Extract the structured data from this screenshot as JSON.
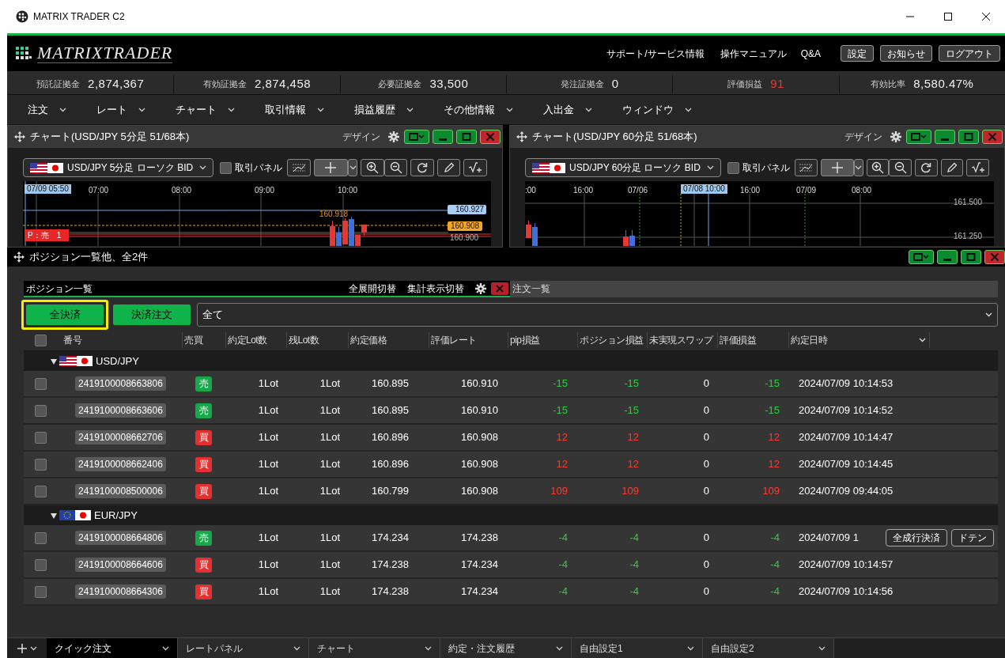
{
  "window": {
    "title": "MATRIX TRADER C2"
  },
  "header": {
    "logo": "MATRIXTRADER",
    "links": [
      "サポート/サービス情報",
      "操作マニュアル",
      "Q&A"
    ],
    "buttons": [
      "設定",
      "お知らせ",
      "ログアウト"
    ]
  },
  "account": [
    {
      "label": "預託証拠金",
      "value": "2,874,367",
      "kind": "plain"
    },
    {
      "label": "有効証拠金",
      "value": "2,874,458",
      "kind": "plain"
    },
    {
      "label": "必要証拠金",
      "value": "33,500",
      "kind": "plain"
    },
    {
      "label": "発注証拠金",
      "value": "0",
      "kind": "plain"
    },
    {
      "label": "評価損益",
      "value": "91",
      "kind": "gain"
    },
    {
      "label": "有効比率",
      "value": "8,580.47%",
      "kind": "plain"
    }
  ],
  "menu": [
    "注文",
    "レート",
    "チャート",
    "取引情報",
    "損益履歴",
    "その他情報",
    "入出金",
    "ウィンドウ"
  ],
  "charts": [
    {
      "title": "チャート(USD/JPY 5分足 51/68本)",
      "design": "デザイン",
      "symbol": "USD/JPY 5分足 ローソク BID",
      "panel_toggle": {
        "label": "取引パネル",
        "checked": false
      },
      "labels": [
        {
          "text": "07/09 05:50",
          "kind": "time_badge"
        },
        {
          "text": "07:00",
          "kind": "time"
        },
        {
          "text": "08:00",
          "kind": "time"
        },
        {
          "text": "09:00",
          "kind": "time"
        },
        {
          "text": "10:00",
          "kind": "time"
        },
        {
          "text": "160.918",
          "kind": "high"
        },
        {
          "text": "160.927",
          "kind": "ask_tag"
        },
        {
          "text": "160.908",
          "kind": "bid_tag"
        },
        {
          "text": "P：売　1",
          "kind": "position_tag"
        },
        {
          "text": "160.900",
          "kind": "price"
        }
      ]
    },
    {
      "title": "チャート(USD/JPY 60分足 51/68本)",
      "design": "デザイン",
      "symbol": "USD/JPY 60分足 ローソク BID",
      "panel_toggle": {
        "label": "取引パネル",
        "checked": false
      },
      "labels": [
        {
          "text": ":00",
          "kind": "time"
        },
        {
          "text": "16:00",
          "kind": "time"
        },
        {
          "text": "07/06",
          "kind": "time"
        },
        {
          "text": "07/08 10:00",
          "kind": "time_badge"
        },
        {
          "text": "16:00",
          "kind": "time"
        },
        {
          "text": "07/09",
          "kind": "time"
        },
        {
          "text": "08:00",
          "kind": "time"
        },
        {
          "text": "161.500",
          "kind": "price"
        },
        {
          "text": "161.250",
          "kind": "price"
        }
      ]
    }
  ],
  "positions": {
    "title": "ポジション一覧他、全2件",
    "tabs": [
      {
        "label": "ポジション一覧",
        "selected": true
      },
      {
        "label": "注文一覧",
        "selected": false
      }
    ],
    "tab_actions": [
      "全展開切替",
      "集計表示切替"
    ],
    "buttons": [
      {
        "label": "全決済",
        "highlighted": true
      },
      {
        "label": "決済注文",
        "highlighted": false
      }
    ],
    "filter": "全て",
    "select_all": false,
    "columns": [
      "番号",
      "売買",
      "約定Lot数",
      "残Lot数",
      "約定価格",
      "評価レート",
      "pip損益",
      "ポジション損益",
      "未実現スワップ",
      "評価損益",
      "約定日時"
    ],
    "groups": [
      {
        "pair": "USD/JPY",
        "kind": "usd",
        "expanded": true,
        "rows": [
          {
            "id": "2419100008663806",
            "kind": "sell",
            "side_label": "売",
            "lot": "1Lot",
            "remaining": "1Lot",
            "price": "160.895",
            "rate": "160.910",
            "pip": "-15",
            "position_pl": "-15",
            "swap": "0",
            "pl": "-15",
            "color": "#2ecc40",
            "time": "2024/07/09 10:14:53",
            "checked": false
          },
          {
            "id": "2419100008663606",
            "kind": "sell",
            "side_label": "売",
            "lot": "1Lot",
            "remaining": "1Lot",
            "price": "160.895",
            "rate": "160.910",
            "pip": "-15",
            "position_pl": "-15",
            "swap": "0",
            "pl": "-15",
            "color": "#2ecc40",
            "time": "2024/07/09 10:14:52",
            "checked": false
          },
          {
            "id": "2419100008662706",
            "kind": "buy",
            "side_label": "買",
            "lot": "1Lot",
            "remaining": "1Lot",
            "price": "160.896",
            "rate": "160.908",
            "pip": "12",
            "position_pl": "12",
            "swap": "0",
            "pl": "12",
            "color": "#ff3b30",
            "time": "2024/07/09 10:14:47",
            "checked": false
          },
          {
            "id": "2419100008662406",
            "kind": "buy",
            "side_label": "買",
            "lot": "1Lot",
            "remaining": "1Lot",
            "price": "160.896",
            "rate": "160.908",
            "pip": "12",
            "position_pl": "12",
            "swap": "0",
            "pl": "12",
            "color": "#ff3b30",
            "time": "2024/07/09 10:14:45",
            "checked": false
          },
          {
            "id": "2419100008500006",
            "kind": "buy",
            "side_label": "買",
            "lot": "1Lot",
            "remaining": "1Lot",
            "price": "160.799",
            "rate": "160.908",
            "pip": "109",
            "position_pl": "109",
            "swap": "0",
            "pl": "109",
            "color": "#ff3b30",
            "time": "2024/07/09 09:44:05",
            "checked": false
          }
        ]
      },
      {
        "pair": "EUR/JPY",
        "kind": "eur",
        "expanded": true,
        "rows": [
          {
            "id": "2419100008664806",
            "kind": "sell",
            "side_label": "売",
            "lot": "1Lot",
            "remaining": "1Lot",
            "price": "174.234",
            "rate": "174.238",
            "pip": "-4",
            "position_pl": "-4",
            "swap": "0",
            "pl": "-4",
            "color": "#2ecc40",
            "time": "2024/07/09 1",
            "checked": false,
            "actions": [
              "全成行決済",
              "ドテン"
            ]
          },
          {
            "id": "2419100008664606",
            "kind": "buy",
            "side_label": "買",
            "lot": "1Lot",
            "remaining": "1Lot",
            "price": "174.238",
            "rate": "174.234",
            "pip": "-4",
            "position_pl": "-4",
            "swap": "0",
            "pl": "-4",
            "color": "#2ecc40",
            "time": "2024/07/09 10:14:57",
            "checked": false
          },
          {
            "id": "2419100008664306",
            "kind": "buy",
            "side_label": "買",
            "lot": "1Lot",
            "remaining": "1Lot",
            "price": "174.238",
            "rate": "174.234",
            "pip": "-4",
            "position_pl": "-4",
            "swap": "0",
            "pl": "-4",
            "color": "#2ecc40",
            "time": "2024/07/09 10:14:56",
            "checked": false
          }
        ]
      }
    ]
  },
  "bottom_tabs": [
    {
      "label": "クイック注文",
      "selected": true
    },
    {
      "label": "レートパネル",
      "selected": false
    },
    {
      "label": "チャート",
      "selected": false
    },
    {
      "label": "約定・注文履歴",
      "selected": false
    },
    {
      "label": "自由設定1",
      "selected": false
    },
    {
      "label": "自由設定2",
      "selected": false
    }
  ]
}
